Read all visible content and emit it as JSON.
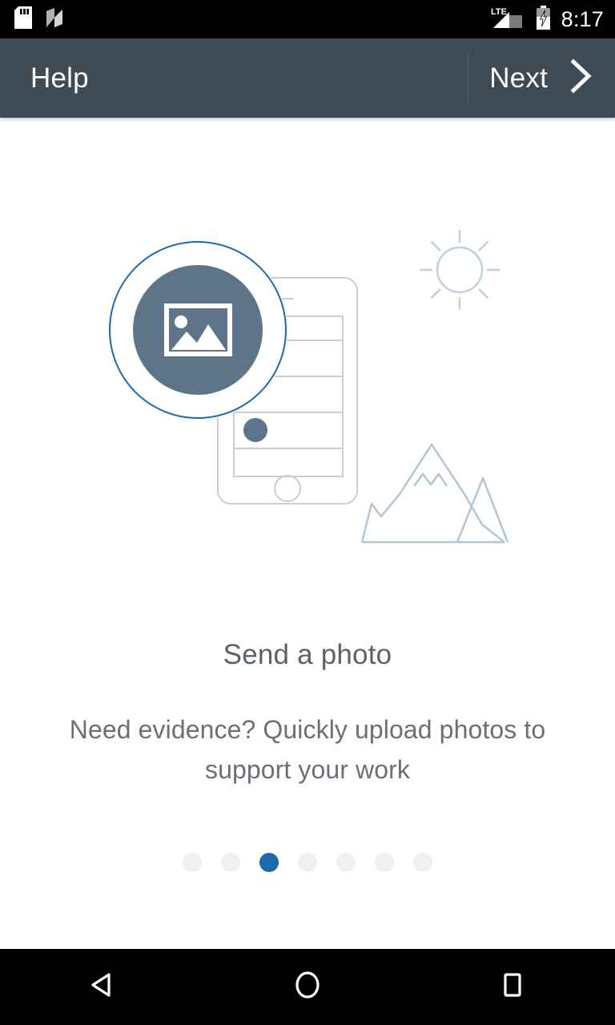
{
  "status_bar": {
    "icons": [
      "sd-card-icon",
      "android-nougat-icon"
    ],
    "network_label": "LTE",
    "signal_icon": "signal-bars-icon",
    "battery_icon": "battery-charging-icon",
    "clock": "8:17"
  },
  "app_bar": {
    "title": "Help",
    "next_label": "Next",
    "next_icon": "chevron-right-icon",
    "background_color": "#3e4a54",
    "text_color": "#ffffff"
  },
  "illustration": {
    "name": "send-a-photo-illustration",
    "badge_icon": "image-photo-icon",
    "badge_fill_color": "#5d7489",
    "badge_ring_color": "#1b6bad",
    "phone_icon": "smartphone-outline-icon",
    "sun_icon": "sun-icon",
    "mountains_icon": "mountains-icon",
    "line_color": "#c9ced2",
    "scenery_color": "#b6c5d6"
  },
  "main": {
    "title": "Send a photo",
    "subtitle": "Need evidence? Quickly upload photos to support your work",
    "title_color": "#5c6268",
    "subtitle_color": "#6a7076"
  },
  "pager": {
    "total": 7,
    "active_index": 2,
    "active_color": "#1b6bad",
    "inactive_color": "#f0f0f0",
    "dots": [
      {
        "label": "page-1",
        "active": false
      },
      {
        "label": "page-2",
        "active": false
      },
      {
        "label": "page-3",
        "active": true
      },
      {
        "label": "page-4",
        "active": false
      },
      {
        "label": "page-5",
        "active": false
      },
      {
        "label": "page-6",
        "active": false
      },
      {
        "label": "page-7",
        "active": false
      }
    ]
  },
  "nav_bar": {
    "back_icon": "back-triangle-icon",
    "home_icon": "home-circle-icon",
    "recents_icon": "recents-square-icon",
    "background_color": "#000000"
  }
}
